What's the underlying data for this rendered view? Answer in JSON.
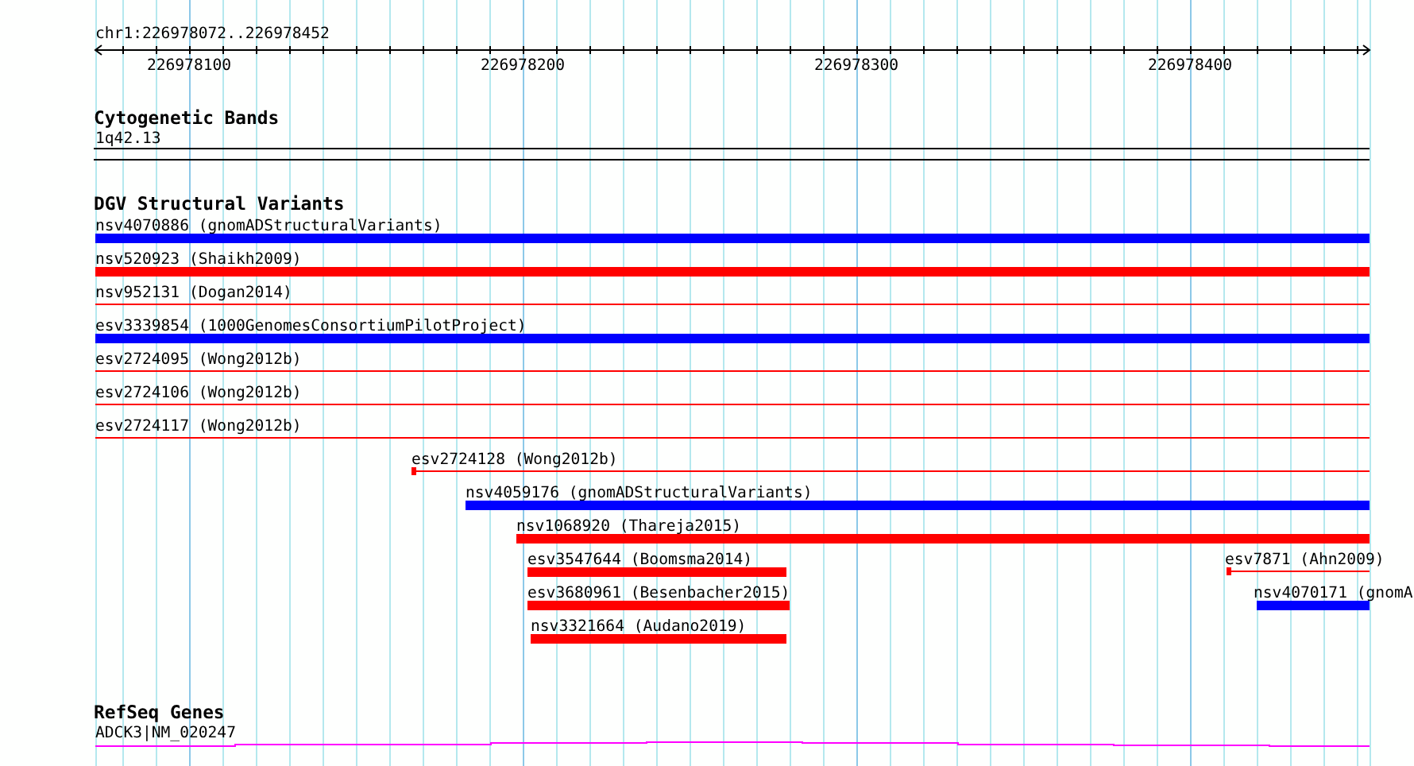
{
  "ruler": {
    "title": "chr1:226978072..226978452",
    "ticks": [
      "226978100",
      "226978200",
      "226978300",
      "226978400"
    ]
  },
  "tracks": [
    {
      "title": "Cytogenetic Bands",
      "kind": "bands",
      "features": [
        {
          "label": "1q42.13"
        }
      ]
    },
    {
      "title": "DGV Structural Variants",
      "kind": "variants",
      "features": [
        {
          "label": "nsv4070886 (gnomADStructuralVariants)",
          "kind": "bar",
          "color": "#0000ff"
        },
        {
          "label": "nsv520923 (Shaikh2009)",
          "kind": "bar",
          "color": "#ff0000"
        },
        {
          "label": "nsv952131 (Dogan2014)",
          "kind": "line",
          "color": "#ff0000"
        },
        {
          "label": "esv3339854 (1000GenomesConsortiumPilotProject)",
          "kind": "bar",
          "color": "#0000ff"
        },
        {
          "label": "esv2724095 (Wong2012b)",
          "kind": "line",
          "color": "#ff0000"
        },
        {
          "label": "esv2724106 (Wong2012b)",
          "kind": "line",
          "color": "#ff0000"
        },
        {
          "label": "esv2724117 (Wong2012b)",
          "kind": "line",
          "color": "#ff0000"
        },
        {
          "label": "esv2724128 (Wong2012b)",
          "kind": "line",
          "color": "#ff0000"
        },
        {
          "label": "nsv4059176 (gnomADStructuralVariants)",
          "kind": "bar",
          "color": "#0000ff"
        },
        {
          "label": "nsv1068920 (Thareja2015)",
          "kind": "bar",
          "color": "#ff0000"
        },
        {
          "label": "esv3547644 (Boomsma2014)",
          "kind": "bar",
          "color": "#ff0000"
        },
        {
          "label": "esv7871 (Ahn2009)",
          "kind": "line",
          "color": "#ff0000"
        },
        {
          "label": "esv3680961 (Besenbacher2015)",
          "kind": "bar",
          "color": "#ff0000"
        },
        {
          "label": "nsv4070171 (gnomA",
          "kind": "bar",
          "color": "#0000ff"
        },
        {
          "label": "nsv3321664 (Audano2019)",
          "kind": "bar",
          "color": "#ff0000"
        }
      ]
    },
    {
      "title": "RefSeq Genes",
      "kind": "genes",
      "features": [
        {
          "label": "ADCK3|NM_020247"
        }
      ]
    }
  ]
}
